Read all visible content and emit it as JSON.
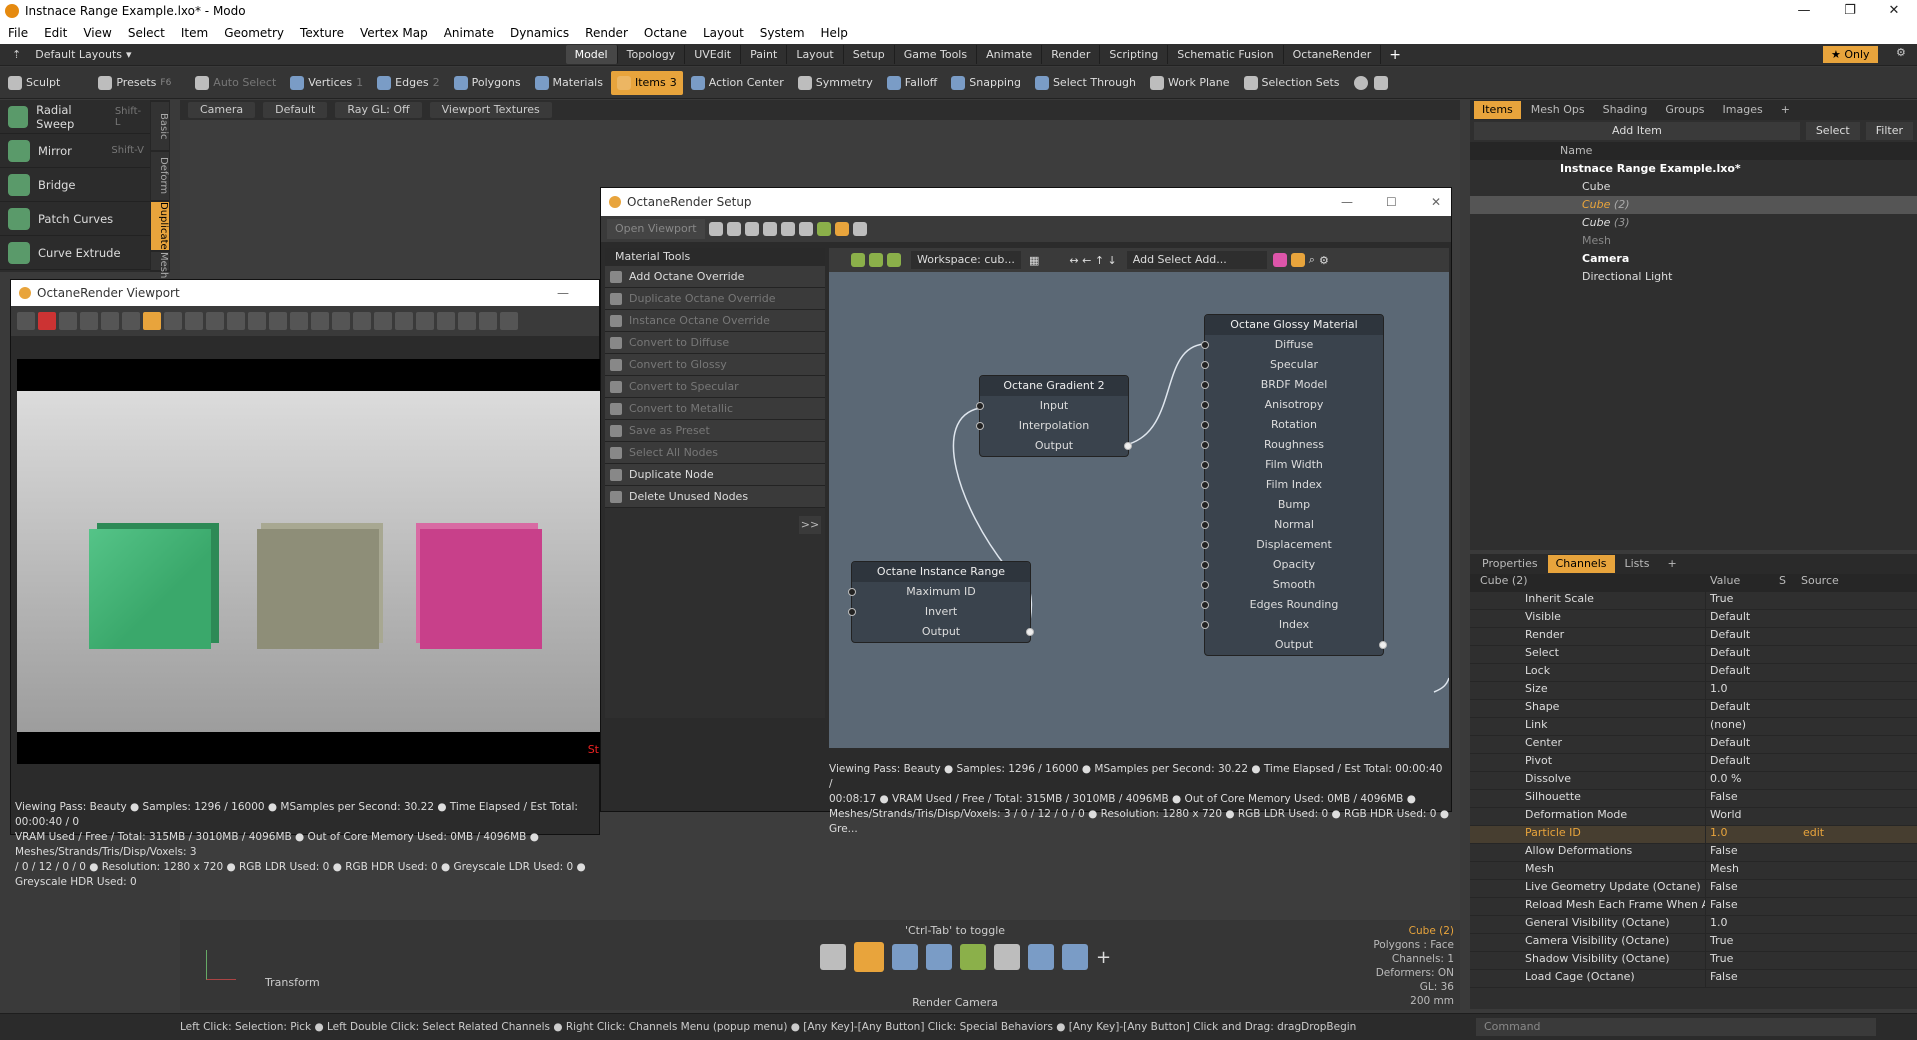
{
  "app": {
    "title": "Instnace Range Example.lxo* - Modo"
  },
  "menu": [
    "File",
    "Edit",
    "View",
    "Select",
    "Item",
    "Geometry",
    "Texture",
    "Vertex Map",
    "Animate",
    "Dynamics",
    "Render",
    "Octane",
    "Layout",
    "System",
    "Help"
  ],
  "layoutbar": {
    "layouts_label": "Default Layouts",
    "tabs": [
      "Model",
      "Topology",
      "UVEdit",
      "Paint",
      "Layout",
      "Setup",
      "Game Tools",
      "Animate",
      "Render",
      "Scripting",
      "Schematic Fusion",
      "OctaneRender"
    ],
    "only": "Only"
  },
  "toolbar": {
    "sculpt": "Sculpt",
    "presets": "Presets",
    "presets_key": "F6",
    "auto_select": "Auto Select",
    "vertices": "Vertices",
    "edges": "Edges",
    "polygons": "Polygons",
    "materials": "Materials",
    "items": "Items",
    "action_center": "Action Center",
    "symmetry": "Symmetry",
    "falloff": "Falloff",
    "snapping": "Snapping",
    "select_through": "Select Through",
    "work_plane": "Work Plane",
    "selection_sets": "Selection Sets",
    "vert_count": "1",
    "edge_count": "2",
    "item_count": "3"
  },
  "left_tools": [
    {
      "label": "Radial Sweep",
      "shortcut": "Shift-L"
    },
    {
      "label": "Mirror",
      "shortcut": "Shift-V"
    },
    {
      "label": "Bridge",
      "shortcut": ""
    },
    {
      "label": "Patch Curves",
      "shortcut": ""
    },
    {
      "label": "Curve Extrude",
      "shortcut": ""
    }
  ],
  "vtabs": [
    "Basic",
    "Deform",
    "Duplicate",
    "Mesh"
  ],
  "viewport_bar": {
    "camera": "Camera",
    "default": "Default",
    "raygl": "Ray GL: Off",
    "textures": "Viewport Textures"
  },
  "octane_viewport": {
    "title": "OctaneRender Viewport",
    "status1": "Viewing Pass: Beauty ● Samples: 1296 / 16000 ● MSamples per Second: 30.22 ● Time Elapsed / Est Total: 00:00:40 / 0",
    "status2": "VRAM Used / Free / Total: 315MB / 3010MB / 4096MB ● Out of Core Memory Used: 0MB / 4096MB ● Meshes/Strands/Tris/Disp/Voxels: 3",
    "status3": "/ 0 / 12 / 0 / 0 ● Resolution: 1280 x 720 ● RGB LDR Used: 0 ● RGB HDR Used: 0 ● Greyscale LDR Used: 0 ● Greyscale HDR Used: 0",
    "corner_text": "St",
    "colors": {
      "green": "#3aa86b",
      "grey": "#8e8e78",
      "pink": "#c8408a"
    }
  },
  "octane_setup": {
    "title": "OctaneRender Setup",
    "open_viewport": "Open Viewport",
    "material_tools": "Material Tools",
    "items": [
      {
        "label": "Add Octane Override",
        "enabled": true
      },
      {
        "label": "Duplicate Octane Override",
        "enabled": false
      },
      {
        "label": "Instance Octane Override",
        "enabled": false
      },
      {
        "label": "Convert to Diffuse",
        "enabled": false
      },
      {
        "label": "Convert to Glossy",
        "enabled": false
      },
      {
        "label": "Convert to Specular",
        "enabled": false
      },
      {
        "label": "Convert to Metallic",
        "enabled": false
      },
      {
        "label": "Save as Preset",
        "enabled": false
      },
      {
        "label": "Select All Nodes",
        "enabled": false
      },
      {
        "label": "Duplicate Node",
        "enabled": true
      },
      {
        "label": "Delete Unused Nodes",
        "enabled": true
      }
    ],
    "expand": ">>",
    "workspace": "Workspace: cub...",
    "add_select": "Add Select Add...",
    "nodes": {
      "gradient": {
        "title": "Octane Gradient 2",
        "ports": [
          "Input",
          "Interpolation",
          "Output"
        ]
      },
      "instance": {
        "title": "Octane Instance Range",
        "ports": [
          "Maximum ID",
          "Invert",
          "Output"
        ]
      },
      "glossy": {
        "title": "Octane Glossy Material",
        "ports": [
          "Diffuse",
          "Specular",
          "BRDF Model",
          "Anisotropy",
          "Rotation",
          "Roughness",
          "Film Width",
          "Film Index",
          "Bump",
          "Normal",
          "Displacement",
          "Opacity",
          "Smooth",
          "Edges Rounding",
          "Index",
          "Output"
        ]
      }
    },
    "status1": "Viewing Pass: Beauty ● Samples: 1296 / 16000 ● MSamples per Second: 30.22 ● Time Elapsed / Est Total: 00:00:40 /",
    "status2": "00:08:17 ● VRAM Used / Free / Total: 315MB / 3010MB / 4096MB ● Out of Core Memory Used: 0MB / 4096MB ●",
    "status3": "Meshes/Strands/Tris/Disp/Voxels: 3 / 0 / 12 / 0 / 0 ● Resolution: 1280 x 720 ● RGB LDR Used: 0 ● RGB HDR Used: 0 ● Gre..."
  },
  "items_panel": {
    "tabs": [
      "Items",
      "Mesh Ops",
      "Shading",
      "Groups",
      "Images"
    ],
    "add_item": "Add Item",
    "select": "Select",
    "filter": "Filter",
    "name_col": "Name",
    "rows": [
      {
        "label": "Instnace Range Example.lxo*",
        "indent": 0
      },
      {
        "label": "Cube",
        "indent": 1
      },
      {
        "label": "Cube",
        "suffix": "(2)",
        "indent": 1
      },
      {
        "label": "Cube",
        "suffix": "(3)",
        "indent": 1
      },
      {
        "label": "Mesh",
        "indent": 1
      },
      {
        "label": "Camera",
        "indent": 1
      },
      {
        "label": "Directional Light",
        "indent": 1
      }
    ]
  },
  "props_panel": {
    "tabs": [
      "Properties",
      "Channels",
      "Lists"
    ],
    "item_name": "Cube (2)",
    "value_col": "Value",
    "s_col": "S",
    "source_col": "Source",
    "rows": [
      [
        "Inherit Scale",
        "True"
      ],
      [
        "Visible",
        "Default"
      ],
      [
        "Render",
        "Default"
      ],
      [
        "Select",
        "Default"
      ],
      [
        "Lock",
        "Default"
      ],
      [
        "Size",
        "1.0"
      ],
      [
        "Shape",
        "Default"
      ],
      [
        "Link",
        "(none)"
      ],
      [
        "Center",
        "Default"
      ],
      [
        "Pivot",
        "Default"
      ],
      [
        "Dissolve",
        "0.0 %"
      ],
      [
        "Silhouette",
        "False"
      ],
      [
        "Deformation Mode",
        "World"
      ],
      [
        "Particle ID",
        "1.0"
      ],
      [
        "Allow Deformations",
        "False"
      ],
      [
        "Mesh",
        "Mesh"
      ],
      [
        "Live Geometry Update (Octane)",
        "False"
      ],
      [
        "Reload Mesh Each Frame When Animatin...",
        "False"
      ],
      [
        "General Visibility (Octane)",
        "1.0"
      ],
      [
        "Camera Visibility (Octane)",
        "True"
      ],
      [
        "Shadow Visibility (Octane)",
        "True"
      ],
      [
        "Load Cage (Octane)",
        "False"
      ]
    ],
    "edit": "edit",
    "command_placeholder": "Command"
  },
  "bottom": {
    "toggle_hint": "'Ctrl-Tab' to toggle",
    "render_camera": "Render Camera",
    "transform": "Transform",
    "info": [
      "Cube (2)",
      "Polygons : Face",
      "Channels: 1",
      "Deformers: ON",
      "GL: 36",
      "200 mm"
    ]
  },
  "statusbar": "Left Click: Selection: Pick ● Left Double Click: Select Related Channels ● Right Click: Channels Menu (popup menu) ● [Any Key]-[Any Button] Click: Special Behaviors ● [Any Key]-[Any Button] Click and Drag: dragDropBegin"
}
